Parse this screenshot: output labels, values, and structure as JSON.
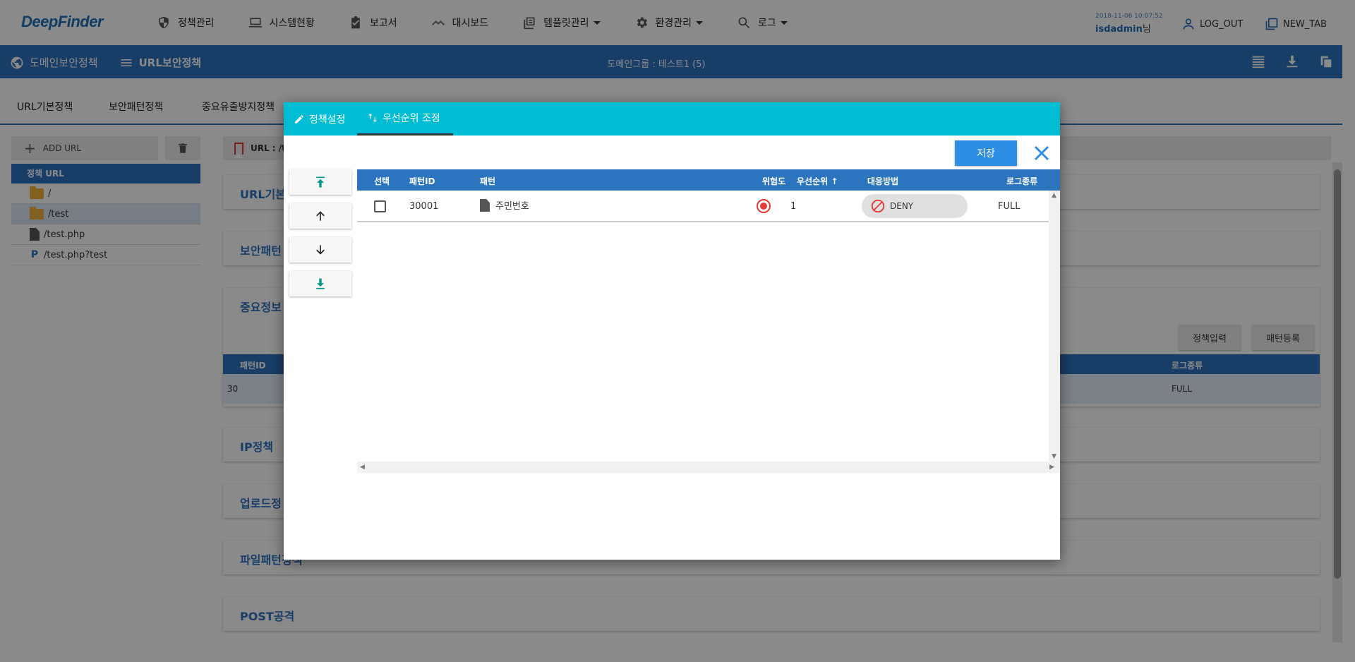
{
  "app": {
    "logo": "DeepFinder",
    "menu": [
      {
        "label": "정책관리",
        "icon": "shield-icon",
        "dropdown": false
      },
      {
        "label": "시스템현황",
        "icon": "laptop-icon",
        "dropdown": false
      },
      {
        "label": "보고서",
        "icon": "clipboard-check-icon",
        "dropdown": false
      },
      {
        "label": "대시보드",
        "icon": "trend-icon",
        "dropdown": false
      },
      {
        "label": "템플릿관리",
        "icon": "library-icon",
        "dropdown": true
      },
      {
        "label": "환경관리",
        "icon": "gear-icon",
        "dropdown": true
      },
      {
        "label": "로그",
        "icon": "search-icon",
        "dropdown": true
      }
    ],
    "user": {
      "datetime": "2018-11-06 10:07:52",
      "name": "isdadmin",
      "suffix": "님"
    },
    "logout": "LOG_OUT",
    "new_tab": "NEW_TAB"
  },
  "bluebar": {
    "domain_policy": "도메인보안정책",
    "url_policy": "URL보안정책",
    "domain_group": "도메인그룹 : 테스트1 (5)"
  },
  "tabs": [
    "URL기본정책",
    "보안패턴정책",
    "중요유출방지정책"
  ],
  "sidebar": {
    "add_url": "ADD URL",
    "tree_header": "정책 URL",
    "tree": [
      {
        "label": "/",
        "type": "folder"
      },
      {
        "label": "/test",
        "type": "folder"
      },
      {
        "label": "/test.php",
        "type": "file"
      },
      {
        "label": "/test.php?test",
        "type": "param"
      }
    ]
  },
  "main": {
    "url_bar": "URL : /t",
    "sections": [
      "URL기본",
      "보안패턴",
      "중요정보",
      "IP정책",
      "업로드정",
      "파일패턴정책",
      "POST공격"
    ],
    "policy_input": "정책입력",
    "pattern_register": "패턴등록",
    "bg_table": {
      "col_pattern_id": "패턴ID",
      "col_log_type": "로그종류",
      "row_id": "30",
      "row_log": "FULL"
    }
  },
  "modal": {
    "tab_policy": "정책설정",
    "tab_priority": "우선순위 조정",
    "save": "저장",
    "columns": {
      "select": "선택",
      "pattern_id": "패턴ID",
      "pattern": "패턴",
      "risk": "위험도",
      "priority": "우선순위",
      "action": "대응방법",
      "log_type": "로그종류"
    },
    "rows": [
      {
        "pattern_id": "30001",
        "pattern": "주민번호",
        "priority": "1",
        "action": "DENY",
        "log_type": "FULL",
        "risk_color": "#e53935"
      }
    ]
  },
  "colors": {
    "accent": "#2d74bf",
    "modal_tab": "#00bcd4",
    "save_button": "#2d8ee3"
  }
}
